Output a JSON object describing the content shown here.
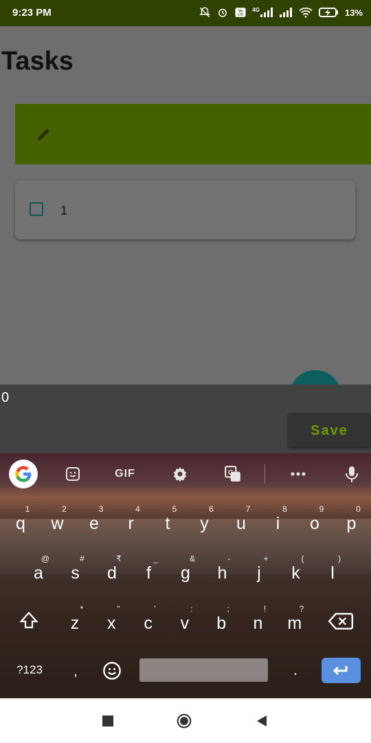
{
  "status_bar": {
    "time": "9:23 PM",
    "battery": "13%",
    "network": "4G"
  },
  "app": {
    "title": "Tasks",
    "tasks": [
      {
        "label": "1",
        "checked": false
      }
    ],
    "colors": {
      "accent": "#466200",
      "fab": "#0d5e5e"
    }
  },
  "dialog": {
    "value": "0",
    "save_label": "Save"
  },
  "keyboard": {
    "toolbar": {
      "google_icon": "google-icon",
      "gif_label": "GIF",
      "items": [
        "sticker-icon",
        "gif",
        "settings-icon",
        "translate-icon",
        "more-icon",
        "mic-icon"
      ]
    },
    "row1": [
      {
        "k": "q",
        "h": "1"
      },
      {
        "k": "w",
        "h": "2"
      },
      {
        "k": "e",
        "h": "3"
      },
      {
        "k": "r",
        "h": "4"
      },
      {
        "k": "t",
        "h": "5"
      },
      {
        "k": "y",
        "h": "6"
      },
      {
        "k": "u",
        "h": "7"
      },
      {
        "k": "i",
        "h": "8"
      },
      {
        "k": "o",
        "h": "9"
      },
      {
        "k": "p",
        "h": "0"
      }
    ],
    "row2": [
      {
        "k": "a",
        "h": "@"
      },
      {
        "k": "s",
        "h": "#"
      },
      {
        "k": "d",
        "h": "₹"
      },
      {
        "k": "f",
        "h": "_"
      },
      {
        "k": "g",
        "h": "&"
      },
      {
        "k": "h",
        "h": "-"
      },
      {
        "k": "j",
        "h": "+"
      },
      {
        "k": "k",
        "h": "("
      },
      {
        "k": "l",
        "h": ")"
      }
    ],
    "row3": [
      {
        "k": "z",
        "h": "*"
      },
      {
        "k": "x",
        "h": "\""
      },
      {
        "k": "c",
        "h": "'"
      },
      {
        "k": "v",
        "h": ":"
      },
      {
        "k": "b",
        "h": ";"
      },
      {
        "k": "n",
        "h": "!"
      },
      {
        "k": "m",
        "h": "?"
      }
    ],
    "symbols_label": "?123",
    "comma": ",",
    "period": "."
  }
}
